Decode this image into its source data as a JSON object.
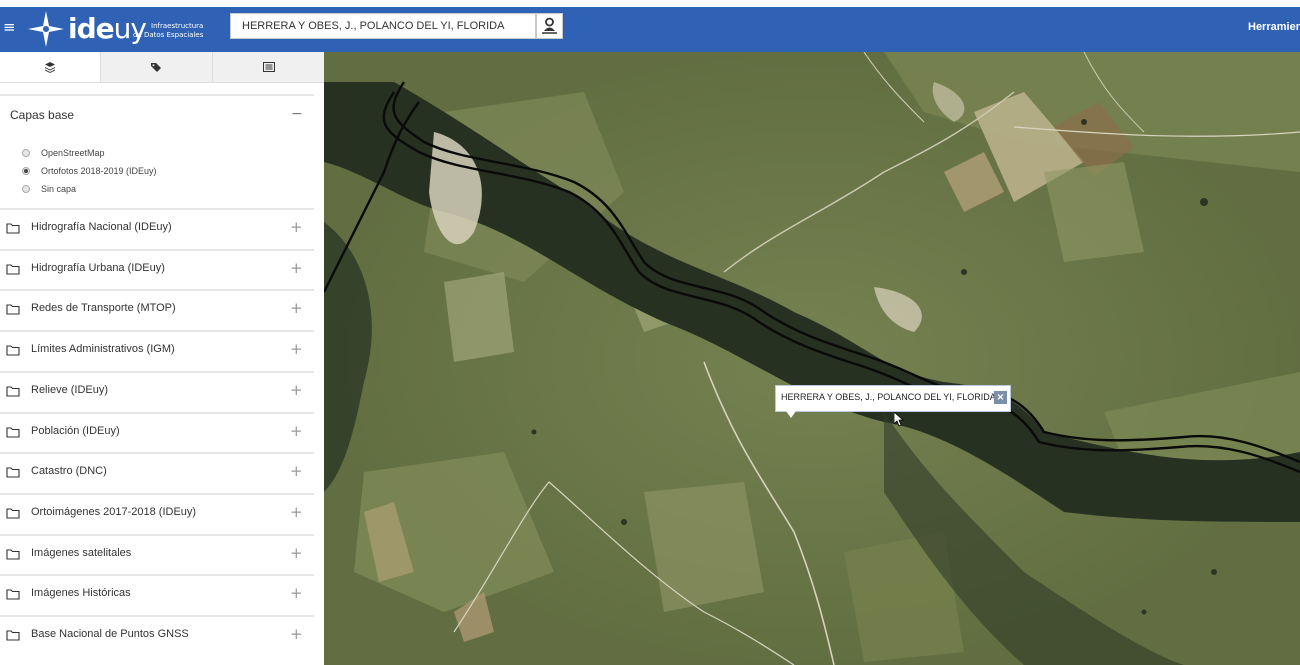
{
  "header": {
    "logo_main": "ideuy",
    "logo_sub_line1": "Infraestructura",
    "logo_sub_line2": "de Datos Espaciales",
    "search_value": "HERRERA Y OBES, J., POLANCO DEL YI, FLORIDA",
    "tools_label": "Herramien"
  },
  "sidebar": {
    "tabs": [
      {
        "icon": "layers-icon"
      },
      {
        "icon": "tags-icon"
      },
      {
        "icon": "list-icon"
      }
    ],
    "base_group": {
      "title": "Capas base",
      "toggle": "−",
      "options": [
        {
          "label": "OpenStreetMap",
          "checked": false
        },
        {
          "label": "Ortofotos 2018-2019 (IDEuy)",
          "checked": true
        },
        {
          "label": "Sin capa",
          "checked": false
        }
      ]
    },
    "groups": [
      {
        "label": "Hidrografía Nacional (IDEuy)"
      },
      {
        "label": "Hidrografía Urbana (IDEuy)"
      },
      {
        "label": "Redes de Transporte (MTOP)"
      },
      {
        "label": "Límites Administrativos (IGM)"
      },
      {
        "label": "Relieve (IDEuy)"
      },
      {
        "label": "Población (IDEuy)"
      },
      {
        "label": "Catastro (DNC)"
      },
      {
        "label": "Ortoimágenes 2017-2018 (IDEuy)"
      },
      {
        "label": "Imágenes satelitales"
      },
      {
        "label": "Imágenes Históricas"
      },
      {
        "label": "Base Nacional de Puntos GNSS"
      }
    ],
    "plus_symbol": "+"
  },
  "map": {
    "popup_text": "HERRERA Y OBES, J., POLANCO DEL YI, FLORIDA",
    "popup_close": "×"
  }
}
